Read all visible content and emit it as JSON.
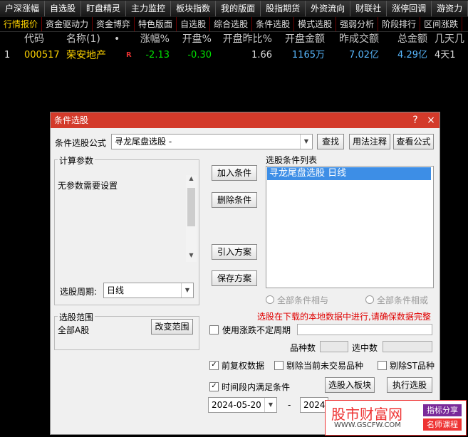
{
  "topnav": [
    "户深涨幅",
    "自选股",
    "盯盘精灵",
    "主力监控",
    "板块指数",
    "我的版面",
    "股指期货",
    "外资流向",
    "财联社",
    "涨停回调",
    "游资力"
  ],
  "subnav": [
    "行情报价",
    "资金驱动力",
    "资金博弈",
    "特色版面",
    "自选股",
    "综合选股",
    "条件选股",
    "模式选股",
    "强弱分析",
    "阶段排行",
    "区间涨跌"
  ],
  "header": {
    "idx": "",
    "code": "代码",
    "name": "名称(1)",
    "dot": "•",
    "chg": "涨幅%",
    "open": "开盘%",
    "ratio": "开盘昨比%",
    "amount": "开盘金额",
    "yvol": "昨成交额",
    "total": "总金额",
    "days": "几天几"
  },
  "row": {
    "idx": "1",
    "code": "000517",
    "name": "荣安地产",
    "flag": "R",
    "chg": "-2.13",
    "open": "-0.30",
    "ratio": "1.66",
    "amount": "1165万",
    "yvol": "7.02亿",
    "total": "4.29亿",
    "days": "4天1"
  },
  "dialog": {
    "title": "条件选股",
    "help_btn": "?",
    "close_btn": "×",
    "formula_label": "条件选股公式",
    "formula_value": "寻龙尾盘选股  -",
    "find_btn": "查找",
    "usage_btn": "用法注释",
    "view_btn": "查看公式",
    "params_group": "计算参数",
    "params_text": "无参数需要设置",
    "add_btn": "加入条件",
    "del_btn": "删除条件",
    "import_btn": "引入方案",
    "save_btn": "保存方案",
    "list_label": "选股条件列表",
    "list_items": [
      "寻龙尾盘选股  日线"
    ],
    "period_label": "选股周期:",
    "period_value": "日线",
    "radio_and": "全部条件相与",
    "radio_or": "全部条件相或",
    "warn": "选股在下载的本地数据中进行,请确保数据完整",
    "range_group": "选股范围",
    "range_value": "全部A股",
    "change_range_btn": "改变范围",
    "use_period_label": "使用涨跌不定周期",
    "count_label": "品种数",
    "selected_label": "选中数",
    "prior_label": "前复权数据",
    "exclude_untraded": "剔除当前未交易品种",
    "exclude_st": "剔除ST品种",
    "time_satisfy": "时间段内满足条件",
    "to_block_btn": "选股入板块",
    "execute_btn": "执行选股",
    "date_from": "2024-05-20",
    "date_sep": "-",
    "date_to": "2024-",
    "check_mark": "✓"
  },
  "watermark": {
    "site": "股市财富网",
    "url": "WWW.GSCFW.COM",
    "tag1": "指标分享",
    "tag2": "名师课程"
  },
  "colors": {
    "title_bar": "#d33a2a",
    "selected": "#3d8ee6",
    "down": "#00e000",
    "warn": "#e00000",
    "code": "#ffd400"
  }
}
